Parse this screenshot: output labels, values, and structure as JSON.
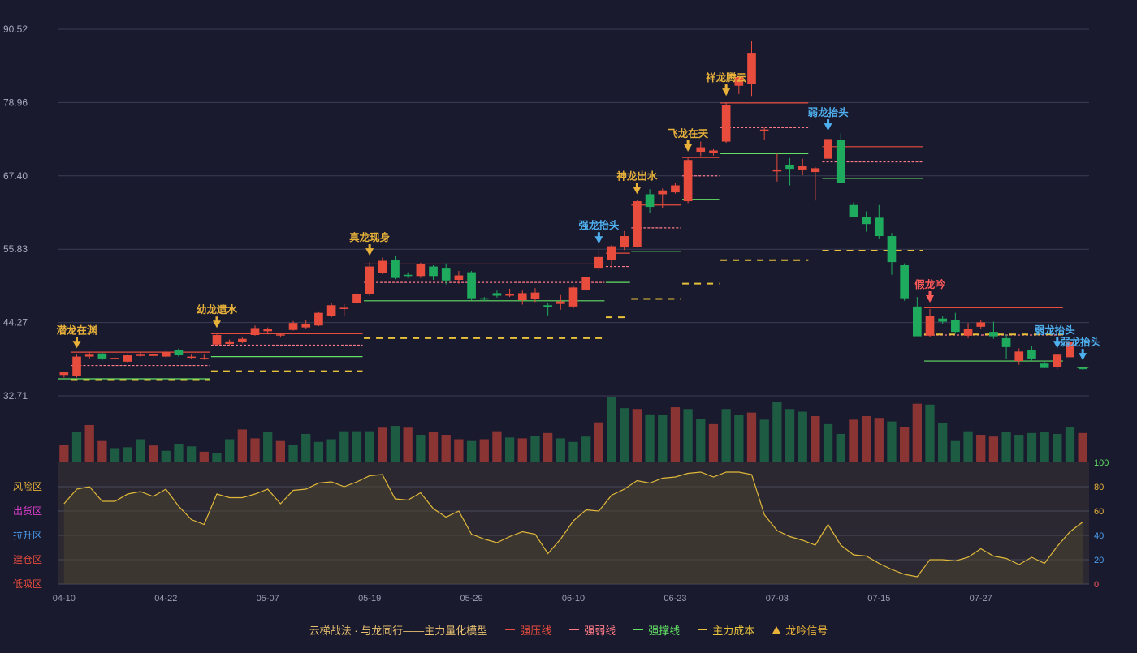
{
  "colors": {
    "background": "#191a2e",
    "up": "#e84c3d",
    "down": "#1fab5e",
    "volume_up": "#8b3434",
    "volume_down": "#1e5b43",
    "pressure": "#e84c3d",
    "weak": "#ff7b88",
    "support": "#62e064",
    "cost": "#e8c23a",
    "signal_gold": "#e8b23a",
    "signal_blue": "#4fb0f0",
    "signal_red": "#ff5a5a",
    "osc_line": "#e0b83a",
    "grid": "#3a3c54"
  },
  "legend": [
    {
      "label": "云梯战法 · 与龙同行——主力量化模型",
      "kind": "text",
      "color": "#e8c070"
    },
    {
      "label": "强压线",
      "kind": "solid",
      "color": "#e84c3d"
    },
    {
      "label": "强弱线",
      "kind": "dash",
      "color": "#ff7b88"
    },
    {
      "label": "强撑线",
      "kind": "solid",
      "color": "#62e064"
    },
    {
      "label": "主力成本",
      "kind": "dash",
      "color": "#e8c23a"
    },
    {
      "label": "龙吟信号",
      "kind": "tri",
      "color": "#e8b23a"
    }
  ],
  "chart_data": {
    "type": "candlestick",
    "price_axis": {
      "ticks": [
        "90.52",
        "78.96",
        "67.40",
        "55.83",
        "44.27",
        "32.71"
      ],
      "min": 32.71,
      "max": 90.52
    },
    "x_tick_labels": [
      {
        "index": 0,
        "label": "04-10"
      },
      {
        "index": 8,
        "label": "04-22"
      },
      {
        "index": 16,
        "label": "05-07"
      },
      {
        "index": 24,
        "label": "05-19"
      },
      {
        "index": 32,
        "label": "05-29"
      },
      {
        "index": 40,
        "label": "06-10"
      },
      {
        "index": 48,
        "label": "06-23"
      },
      {
        "index": 56,
        "label": "07-03"
      },
      {
        "index": 64,
        "label": "07-15"
      },
      {
        "index": 72,
        "label": "07-27"
      }
    ],
    "ohlc": [
      [
        36.0,
        36.5,
        35.6,
        36.5
      ],
      [
        35.8,
        39.2,
        35.6,
        38.9
      ],
      [
        38.9,
        39.7,
        38.5,
        39.2
      ],
      [
        39.4,
        39.6,
        38.3,
        38.6
      ],
      [
        38.6,
        39.0,
        38.3,
        38.7
      ],
      [
        38.1,
        39.3,
        37.9,
        39.1
      ],
      [
        39.1,
        39.7,
        38.9,
        39.2
      ],
      [
        39.0,
        39.4,
        38.7,
        39.3
      ],
      [
        38.9,
        39.8,
        38.7,
        39.6
      ],
      [
        39.9,
        40.2,
        38.9,
        39.1
      ],
      [
        38.8,
        39.2,
        38.6,
        38.9
      ],
      [
        38.6,
        39.2,
        38.4,
        38.7
      ],
      [
        40.8,
        42.4,
        40.6,
        42.3
      ],
      [
        40.9,
        41.6,
        40.6,
        41.3
      ],
      [
        41.2,
        41.9,
        41.0,
        41.7
      ],
      [
        42.3,
        43.8,
        42.2,
        43.4
      ],
      [
        42.9,
        43.5,
        42.4,
        43.3
      ],
      [
        42.3,
        42.7,
        41.9,
        42.4
      ],
      [
        43.1,
        44.5,
        43.0,
        44.2
      ],
      [
        43.5,
        44.7,
        43.2,
        44.1
      ],
      [
        43.8,
        45.9,
        43.7,
        45.8
      ],
      [
        45.3,
        47.3,
        45.1,
        47.0
      ],
      [
        46.4,
        47.2,
        45.3,
        46.6
      ],
      [
        47.4,
        50.2,
        47.0,
        48.7
      ],
      [
        48.7,
        53.8,
        48.5,
        53.1
      ],
      [
        52.1,
        54.5,
        51.9,
        54.0
      ],
      [
        54.2,
        54.8,
        51.1,
        51.3
      ],
      [
        51.8,
        52.2,
        51.3,
        51.6
      ],
      [
        51.6,
        53.7,
        51.3,
        53.5
      ],
      [
        53.1,
        53.3,
        51.0,
        51.6
      ],
      [
        52.9,
        53.6,
        50.3,
        50.9
      ],
      [
        51.0,
        52.4,
        50.4,
        51.7
      ],
      [
        52.2,
        52.4,
        47.8,
        48.1
      ],
      [
        48.1,
        48.3,
        47.7,
        47.9
      ],
      [
        48.9,
        49.3,
        48.2,
        48.5
      ],
      [
        48.6,
        49.6,
        48.3,
        48.7
      ],
      [
        47.8,
        49.3,
        47.1,
        48.9
      ],
      [
        48.0,
        49.7,
        47.5,
        49.0
      ],
      [
        47.0,
        47.4,
        45.4,
        46.7
      ],
      [
        47.2,
        48.6,
        46.3,
        47.6
      ],
      [
        46.8,
        50.1,
        46.5,
        49.8
      ],
      [
        49.4,
        51.5,
        49.2,
        51.4
      ],
      [
        52.9,
        55.7,
        52.4,
        54.6
      ],
      [
        54.1,
        56.5,
        52.9,
        56.3
      ],
      [
        56.1,
        58.7,
        55.7,
        57.9
      ],
      [
        56.2,
        63.5,
        56.1,
        63.4
      ],
      [
        64.5,
        65.3,
        61.5,
        62.5
      ],
      [
        64.5,
        65.4,
        62.3,
        65.1
      ],
      [
        64.8,
        66.3,
        64.6,
        65.9
      ],
      [
        63.4,
        70.2,
        63.1,
        69.9
      ],
      [
        71.2,
        72.8,
        70.5,
        71.9
      ],
      [
        71.0,
        71.6,
        70.6,
        71.4
      ],
      [
        72.8,
        79.0,
        72.6,
        78.6
      ],
      [
        81.6,
        82.3,
        80.3,
        83.0
      ],
      [
        81.9,
        88.6,
        80.0,
        86.8
      ],
      [
        74.5,
        75.1,
        73.1,
        74.7
      ],
      [
        68.1,
        70.9,
        66.5,
        68.4
      ],
      [
        69.1,
        70.2,
        65.9,
        68.5
      ],
      [
        68.4,
        70.1,
        67.5,
        68.9
      ],
      [
        68.0,
        68.8,
        63.5,
        68.6
      ],
      [
        70.1,
        73.5,
        69.6,
        73.2
      ],
      [
        73.0,
        74.1,
        66.3,
        66.3
      ],
      [
        62.8,
        63.2,
        61.1,
        60.9
      ],
      [
        60.9,
        61.8,
        58.6,
        59.8
      ],
      [
        60.8,
        62.8,
        57.4,
        57.9
      ],
      [
        57.9,
        58.4,
        51.8,
        53.8
      ],
      [
        53.3,
        53.6,
        47.7,
        48.1
      ],
      [
        46.8,
        48.3,
        42.3,
        42.1
      ],
      [
        42.2,
        46.4,
        42.0,
        45.3
      ],
      [
        44.9,
        45.3,
        44.0,
        44.4
      ],
      [
        44.7,
        45.8,
        42.5,
        42.8
      ],
      [
        42.2,
        44.2,
        41.8,
        43.3
      ],
      [
        43.6,
        44.6,
        43.3,
        44.3
      ],
      [
        42.8,
        44.4,
        41.7,
        42.1
      ],
      [
        41.8,
        42.4,
        38.6,
        40.4
      ],
      [
        38.2,
        40.2,
        37.6,
        39.7
      ],
      [
        40.0,
        40.6,
        38.2,
        38.6
      ],
      [
        37.8,
        38.3,
        37.1,
        37.1
      ],
      [
        37.3,
        39.2,
        36.9,
        39.2
      ],
      [
        38.8,
        41.4,
        38.6,
        41.2
      ],
      [
        37.1,
        37.3,
        36.8,
        37.0
      ]
    ],
    "volume_up_mask": [
      1,
      0,
      1,
      1,
      0,
      0,
      0,
      1,
      0,
      0,
      0,
      1,
      0,
      0,
      1,
      1,
      0,
      1,
      0,
      0,
      0,
      0,
      0,
      0,
      0,
      1,
      0,
      1,
      0,
      1,
      1,
      1,
      0,
      1,
      1,
      0,
      1,
      0,
      1,
      0,
      0,
      0,
      1,
      0,
      0,
      1,
      0,
      0,
      1,
      0,
      0,
      1,
      0,
      0,
      1,
      0,
      0,
      0,
      0,
      1,
      0,
      0,
      1,
      1,
      1,
      0,
      1,
      1,
      0,
      0,
      0,
      0,
      1,
      1,
      0,
      0,
      0,
      0,
      0,
      0,
      1
    ],
    "volume": [
      20,
      34,
      42,
      24,
      16,
      17,
      26,
      19,
      13,
      21,
      18,
      12,
      10,
      26,
      37,
      27,
      34,
      24,
      20,
      32,
      23,
      26,
      35,
      35,
      35,
      39,
      41,
      39,
      31,
      34,
      31,
      26,
      24,
      26,
      35,
      28,
      27,
      30,
      33,
      27,
      23,
      29,
      45,
      73,
      61,
      60,
      54,
      53,
      62,
      60,
      49,
      43,
      60,
      53,
      56,
      48,
      68,
      60,
      57,
      52,
      43,
      32,
      48,
      52,
      50,
      46,
      40,
      66,
      65,
      44,
      24,
      35,
      31,
      29,
      34,
      31,
      33,
      34,
      32,
      40,
      33
    ],
    "oscillator": {
      "axis_ticks": [
        "100",
        "80",
        "60",
        "40",
        "20",
        "0"
      ],
      "zone_labels": [
        "风险区",
        "出货区",
        "拉升区",
        "建仓区",
        "低吸区"
      ],
      "zone_colors": [
        "#e8b23a",
        "#e03fd0",
        "#4c9ef0",
        "#e84c3d",
        "#e84c3d"
      ],
      "values": [
        66,
        78,
        80,
        68,
        68,
        74,
        76,
        72,
        78,
        64,
        53,
        49,
        74,
        71,
        71,
        74,
        78,
        66,
        77,
        78,
        83,
        84,
        80,
        84,
        89,
        90,
        70,
        69,
        75,
        62,
        55,
        60,
        41,
        37,
        34,
        39,
        43,
        41,
        25,
        37,
        52,
        61,
        60,
        73,
        78,
        85,
        83,
        87,
        88,
        91,
        92,
        88,
        92,
        92,
        90,
        57,
        44,
        39,
        36,
        32,
        49,
        32,
        24,
        23,
        17,
        12,
        8,
        6,
        20,
        20,
        19,
        22,
        29,
        23,
        21,
        16,
        22,
        17,
        31,
        43,
        51
      ]
    },
    "level_segments": [
      {
        "kind": "pressure",
        "from": 1,
        "to": 11,
        "price": 39.6
      },
      {
        "kind": "weak",
        "from": 1,
        "to": 11,
        "price": 37.5
      },
      {
        "kind": "support",
        "from": 0,
        "to": 11,
        "price": 35.4
      },
      {
        "kind": "cost",
        "from": 1,
        "to": 11,
        "price": 35.2
      },
      {
        "kind": "pressure",
        "from": 12,
        "to": 23,
        "price": 42.5
      },
      {
        "kind": "weak",
        "from": 12,
        "to": 23,
        "price": 40.7
      },
      {
        "kind": "support",
        "from": 12,
        "to": 23,
        "price": 38.9
      },
      {
        "kind": "cost",
        "from": 12,
        "to": 23,
        "price": 36.6
      },
      {
        "kind": "pressure",
        "from": 24,
        "to": 42,
        "price": 53.5
      },
      {
        "kind": "weak",
        "from": 24,
        "to": 42,
        "price": 50.6
      },
      {
        "kind": "support",
        "from": 24,
        "to": 42,
        "price": 47.7
      },
      {
        "kind": "cost",
        "from": 24,
        "to": 42,
        "price": 41.8
      },
      {
        "kind": "pressure",
        "from": 43,
        "to": 44,
        "price": 55.2
      },
      {
        "kind": "weak",
        "from": 43,
        "to": 44,
        "price": 53.1
      },
      {
        "kind": "support",
        "from": 43,
        "to": 44,
        "price": 50.6
      },
      {
        "kind": "cost",
        "from": 43,
        "to": 44,
        "price": 45.1
      },
      {
        "kind": "pressure",
        "from": 45,
        "to": 48,
        "price": 62.8
      },
      {
        "kind": "weak",
        "from": 45,
        "to": 48,
        "price": 59.2
      },
      {
        "kind": "support",
        "from": 45,
        "to": 48,
        "price": 55.5
      },
      {
        "kind": "cost",
        "from": 45,
        "to": 48,
        "price": 48.0
      },
      {
        "kind": "pressure",
        "from": 49,
        "to": 51,
        "price": 70.3
      },
      {
        "kind": "weak",
        "from": 49,
        "to": 51,
        "price": 67.4
      },
      {
        "kind": "support",
        "from": 49,
        "to": 51,
        "price": 63.7
      },
      {
        "kind": "cost",
        "from": 49,
        "to": 51,
        "price": 50.4
      },
      {
        "kind": "pressure",
        "from": 52,
        "to": 58,
        "price": 78.9
      },
      {
        "kind": "weak",
        "from": 52,
        "to": 58,
        "price": 75.0
      },
      {
        "kind": "support",
        "from": 52,
        "to": 58,
        "price": 70.9
      },
      {
        "kind": "cost",
        "from": 52,
        "to": 58,
        "price": 54.1
      },
      {
        "kind": "pressure",
        "from": 60,
        "to": 67,
        "price": 72.0
      },
      {
        "kind": "weak",
        "from": 60,
        "to": 67,
        "price": 69.6
      },
      {
        "kind": "support",
        "from": 60,
        "to": 67,
        "price": 67.0
      },
      {
        "kind": "cost",
        "from": 60,
        "to": 67,
        "price": 55.6
      },
      {
        "kind": "pressure",
        "from": 68,
        "to": 78,
        "price": 46.6
      },
      {
        "kind": "weak",
        "from": 68,
        "to": 78,
        "price": 42.3
      },
      {
        "kind": "support",
        "from": 68,
        "to": 78,
        "price": 38.2
      },
      {
        "kind": "cost",
        "from": 68,
        "to": 78,
        "price": 42.4
      },
      {
        "kind": "support",
        "from": 80,
        "to": 80,
        "price": 37.2
      }
    ],
    "signals": [
      {
        "index": 1,
        "label": "潜龙在渊",
        "color": "gold"
      },
      {
        "index": 12,
        "label": "幼龙遗水",
        "color": "gold"
      },
      {
        "index": 24,
        "label": "真龙现身",
        "color": "gold"
      },
      {
        "index": 42,
        "label": "强龙抬头",
        "color": "blue"
      },
      {
        "index": 45,
        "label": "神龙出水",
        "color": "gold"
      },
      {
        "index": 49,
        "label": "飞龙在天",
        "color": "gold"
      },
      {
        "index": 52,
        "label": "祥龙腾云",
        "color": "gold"
      },
      {
        "index": 60,
        "label": "弱龙抬头",
        "color": "blue"
      },
      {
        "index": 68,
        "label": "假龙吟",
        "color": "red"
      },
      {
        "index": 78,
        "label": "弱龙抬头",
        "color": "blue"
      },
      {
        "index": 80,
        "label": "弱龙抬头",
        "color": "blue"
      }
    ]
  }
}
